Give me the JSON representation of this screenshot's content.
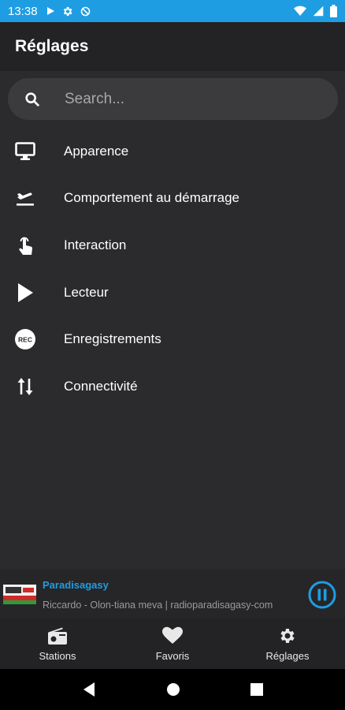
{
  "status_bar": {
    "time": "13:38",
    "left_icons": [
      "play-icon",
      "gear-icon",
      "no-sync-icon"
    ],
    "right_icons": [
      "wifi-icon",
      "signal-icon",
      "battery-icon"
    ]
  },
  "app_bar": {
    "title": "Réglages"
  },
  "search": {
    "placeholder": "Search..."
  },
  "menu": {
    "items": [
      {
        "label": "Apparence",
        "icon": "monitor-icon"
      },
      {
        "label": "Comportement au démarrage",
        "icon": "flight-takeoff-icon"
      },
      {
        "label": "Interaction",
        "icon": "touch-icon"
      },
      {
        "label": "Lecteur",
        "icon": "play-icon"
      },
      {
        "label": "Enregistrements",
        "icon": "rec-icon"
      },
      {
        "label": "Connectivité",
        "icon": "swap-vertical-icon"
      }
    ]
  },
  "player": {
    "station_name": "Paradisagasy",
    "track": "Riccardo - Olon-tiana meva | radioparadisagasy-com",
    "state": "playing"
  },
  "bottom_nav": {
    "items": [
      {
        "label": "Stations",
        "icon": "radio-icon"
      },
      {
        "label": "Favoris",
        "icon": "heart-icon"
      },
      {
        "label": "Réglages",
        "icon": "gear-icon"
      }
    ]
  },
  "colors": {
    "accent": "#1e9de3",
    "background": "#2b2b2d",
    "appbar": "#232325"
  }
}
